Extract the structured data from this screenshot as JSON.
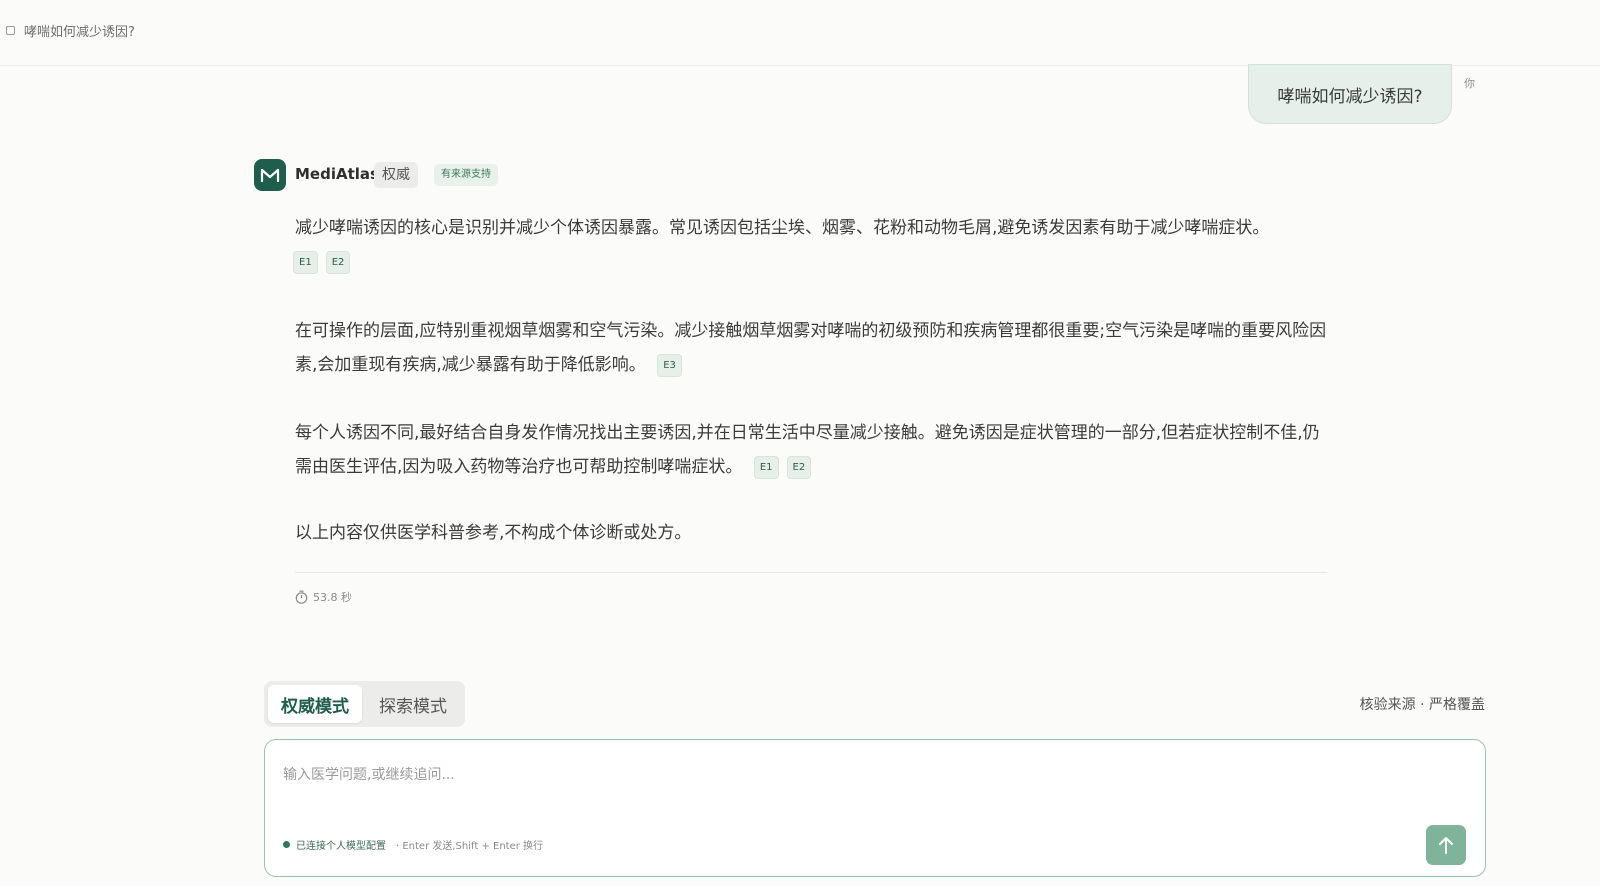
{
  "header": {
    "title": "哮喘如何减少诱因?"
  },
  "user_message": {
    "text": "哮喘如何减少诱因?",
    "label": "你"
  },
  "assistant": {
    "name": "MediAtlas",
    "badge_authority": "权威",
    "badge_source": "有来源支持",
    "paragraphs": [
      {
        "text": "减少哮喘诱因的核心是识别并减少个体诱因暴露。常见诱因包括尘埃、烟雾、花粉和动物毛屑,避免诱发因素有助于减少哮喘症状。",
        "citations": [
          "E1",
          "E2"
        ]
      },
      {
        "text": "在可操作的层面,应特别重视烟草烟雾和空气污染。减少接触烟草烟雾对哮喘的初级预防和疾病管理都很重要;空气污染是哮喘的重要风险因素,会加重现有疾病,减少暴露有助于降低影响。",
        "citations": [
          "E3"
        ]
      },
      {
        "text": "每个人诱因不同,最好结合自身发作情况找出主要诱因,并在日常生活中尽量减少接触。避免诱因是症状管理的一部分,但若症状控制不佳,仍需由医生评估,因为吸入药物等治疗也可帮助控制哮喘症状。",
        "citations": [
          "E1",
          "E2"
        ]
      },
      {
        "text": "以上内容仅供医学科普参考,不构成个体诊断或处方。",
        "citations": []
      }
    ],
    "elapsed": "53.8 秒"
  },
  "composer": {
    "modes": [
      "权威模式",
      "探索模式"
    ],
    "active_mode": "权威模式",
    "mode_description": "核验来源 · 严格覆盖",
    "placeholder": "输入医学问题,或继续追问...",
    "status": "已连接个人模型配置",
    "hint": "· Enter 发送,Shift + Enter 换行"
  },
  "colors": {
    "brand": "#1f5d4c",
    "accent": "#7fb49a",
    "bubble": "#e6efe9"
  }
}
